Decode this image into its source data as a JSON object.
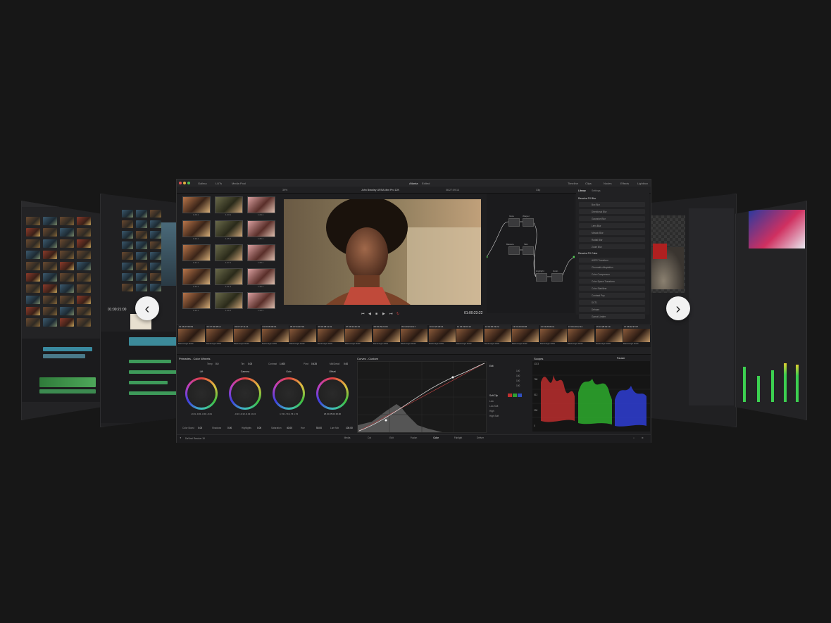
{
  "app": {
    "project_title": "Atlanta",
    "project_status": "Edited",
    "brand_label": "DaVinci Resolve 18"
  },
  "topbar": {
    "gallery": "Gallery",
    "luts": "LUTs",
    "media_pool": "Media Pool",
    "timeline": "Timeline",
    "clips": "Clips",
    "nodes": "Nodes",
    "effects": "Effects",
    "lightbox": "Lightbox"
  },
  "viewer": {
    "zoom": "39%",
    "clip_name": "John Brawley URSA Mini Pro 12K",
    "timecode_top": "06:27:09:14",
    "timecode_bottom": "01:00:23:22",
    "clip_dropdown": "Clip"
  },
  "gallery_stills": [
    "1.29.1",
    "1.23.1",
    "1.24.1",
    "1.30.1",
    "1.25.1",
    "1.26.1",
    "1.31.1",
    "1.27.1",
    "1.28.1",
    "1.32.1",
    "1.21.1",
    "1.33.1",
    "1.35.1",
    "1.36.1",
    "1.34.1"
  ],
  "nodes": [
    "Glow",
    "Warper",
    "Balance",
    "Skin",
    "Highlight",
    "Grain"
  ],
  "library": {
    "tabs": [
      "Library",
      "Settings"
    ],
    "section1": "Resolve FX Blur",
    "blur_items": [
      "Box Blur",
      "Directional Blur",
      "Gaussian Blur",
      "Lens Blur",
      "Mosaic Blur",
      "Radial Blur",
      "Zoom Blur"
    ],
    "section2": "Resolve FX Color",
    "color_items": [
      "ACES Transform",
      "Chromatic Adaptation",
      "Color Compressor",
      "Color Space Transform",
      "Color Stabilizer",
      "Contrast Pop",
      "DCTL",
      "Dehaze",
      "Gamut Limiter"
    ]
  },
  "clips": [
    {
      "num": "01",
      "tc": "06:27:09:09",
      "cap": "Blackmagic RAW"
    },
    {
      "num": "02",
      "tc": "07:02:38:12",
      "cap": "Blackmagic RAW"
    },
    {
      "num": "03",
      "tc": "07:47:11:11",
      "cap": "Blackmagic RAW"
    },
    {
      "num": "04",
      "tc": "06:39:09:01",
      "cap": "Blackmagic RAW"
    },
    {
      "num": "05",
      "tc": "07:34:07:00",
      "cap": "Blackmagic RAW"
    },
    {
      "num": "06",
      "tc": "06:38:11:01",
      "cap": "Blackmagic RAW"
    },
    {
      "num": "07",
      "tc": "06:34:20:16",
      "cap": "Blackmagic RAW"
    },
    {
      "num": "08",
      "tc": "06:29:22:09",
      "cap": "Blackmagic RAW"
    },
    {
      "num": "09",
      "tc": "10:02:20:17",
      "cap": "Blackmagic RAW"
    },
    {
      "num": "10",
      "tc": "10:23:29:21",
      "cap": "Blackmagic RAW"
    },
    {
      "num": "11",
      "tc": "04:29:03:13",
      "cap": "Blackmagic RAW"
    },
    {
      "num": "12",
      "tc": "04:06:23:22",
      "cap": "Blackmagic RAW"
    },
    {
      "num": "13",
      "tc": "04:23:03:08",
      "cap": "Blackmagic RAW"
    },
    {
      "num": "14",
      "tc": "04:26:09:11",
      "cap": "Blackmagic RAW"
    },
    {
      "num": "15",
      "tc": "04:23:12:14",
      "cap": "Blackmagic RAW"
    },
    {
      "num": "16",
      "tc": "04:28:02:19",
      "cap": "Blackmagic RAW"
    },
    {
      "num": "17",
      "tc": "06:32:37:07",
      "cap": "Blackmagic RAW"
    }
  ],
  "primaries": {
    "title": "Primaries - Color Wheels",
    "temp_label": "Temp",
    "temp_val": "0.0",
    "tint_label": "Tint",
    "tint_val": "0.00",
    "contrast_label": "Contrast",
    "contrast_val": "1.000",
    "pivot_label": "Pivot",
    "pivot_val": "0.435",
    "middetail_label": "Mid/Detail",
    "middetail_val": "0.00",
    "wheels": [
      {
        "label": "Lift",
        "vals": "-0.01  -0.01  -0.01  -0.01"
      },
      {
        "label": "Gamma",
        "vals": "-0.13  -0.13  -0.13  -0.13"
      },
      {
        "label": "Gain",
        "vals": "1.74  1.74  1.74  1.74"
      },
      {
        "label": "Offset",
        "vals": "25.00  25.00  25.00"
      }
    ],
    "bottom": [
      {
        "label": "Color Boost",
        "val": "0.00"
      },
      {
        "label": "Shadows",
        "val": "0.00"
      },
      {
        "label": "Highlights",
        "val": "0.00"
      },
      {
        "label": "Saturation",
        "val": "40.00"
      },
      {
        "label": "Hue",
        "val": "50.00"
      },
      {
        "label": "Lum Mix",
        "val": "100.00"
      }
    ]
  },
  "curves": {
    "title": "Curves - Custom",
    "edit_label": "Edit",
    "soft_clip": "Soft Clip",
    "soft_rows": [
      "Low",
      "Low Soft",
      "High",
      "High Soft"
    ],
    "edit_vals": [
      "100",
      "100",
      "100",
      "100"
    ]
  },
  "scopes": {
    "title": "Scopes",
    "mode": "Parade",
    "scale": [
      "1023",
      "768",
      "512",
      "256",
      "0"
    ]
  },
  "pages": [
    "Media",
    "Cut",
    "Edit",
    "Fusion",
    "Color",
    "Fairlight",
    "Deliver"
  ],
  "active_page": "Color",
  "side_left": {
    "timecode": "01:00:21:00"
  },
  "nav": {
    "prev_symbol": "‹",
    "next_symbol": "›"
  }
}
